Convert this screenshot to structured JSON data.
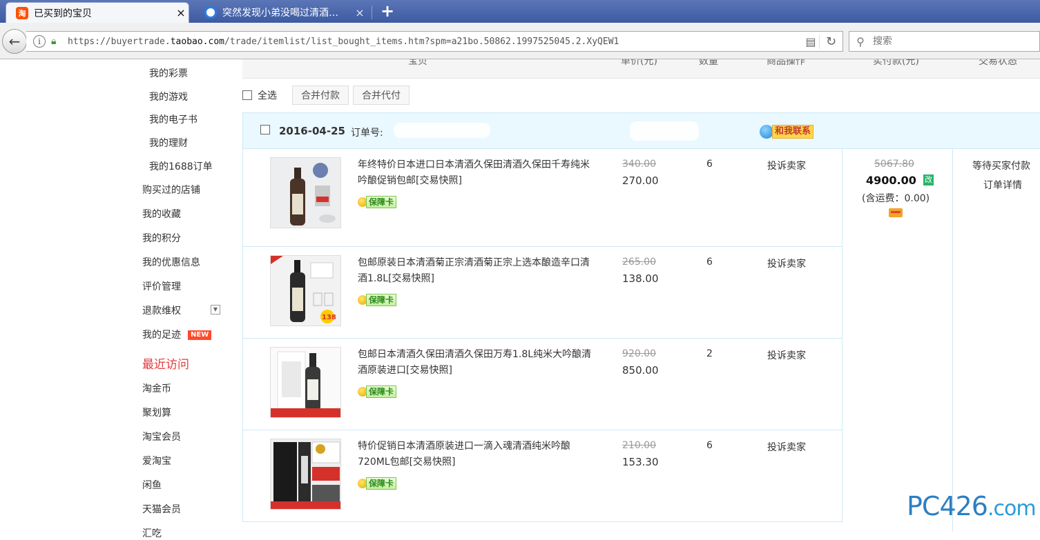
{
  "browser": {
    "tabs": [
      {
        "title": "已买到的宝贝",
        "favicon": "taobao-icon"
      },
      {
        "title": "突然发现小弟没喝过清酒…",
        "favicon": "globe-icon"
      }
    ],
    "new_tab": "+",
    "close": "×",
    "url_host": "https://buyertrade.",
    "url_domain": "taobao.com",
    "url_path": "/trade/itemlist/list_bought_items.htm?spm=a21bo.50862.1997525045.2.XyQEW1",
    "search_placeholder": "搜索"
  },
  "sidebar": {
    "sub_items": [
      "我的彩票",
      "我的游戏",
      "我的电子书",
      "我的理财",
      "我的1688订单"
    ],
    "items": [
      "购买过的店铺",
      "我的收藏",
      "我的积分",
      "我的优惠信息",
      "评价管理",
      "退款维权",
      "我的足迹"
    ],
    "new_badge": "NEW",
    "recent_heading": "最近访问",
    "recent": [
      "淘金币",
      "聚划算",
      "淘宝会员",
      "爱淘宝",
      "闲鱼",
      "天猫会员",
      "汇吃"
    ]
  },
  "table": {
    "columns": [
      "宝贝",
      "单价(元)",
      "数量",
      "商品操作",
      "实付款(元)",
      "交易状态"
    ]
  },
  "bulk": {
    "select_all": "全选",
    "merge_pay": "合并付款",
    "merge_proxy": "合并代付"
  },
  "order": {
    "date": "2016-04-25",
    "order_no_label": "订单号:",
    "contact": "和我联系",
    "items": [
      {
        "title": "年终特价日本进口日本清酒久保田清酒久保田千寿纯米吟酿促销包邮[交易快照]",
        "orig": "340.00",
        "price": "270.00",
        "qty": "6",
        "action": "投诉卖家",
        "badge": "保障卡"
      },
      {
        "title": "包邮原装日本清酒菊正宗清酒菊正宗上选本酿造辛口清酒1.8L[交易快照]",
        "orig": "265.00",
        "price": "138.00",
        "qty": "6",
        "action": "投诉卖家",
        "badge": "保障卡"
      },
      {
        "title": "包邮日本清酒久保田清酒久保田万寿1.8L纯米大吟酿清酒原装进口[交易快照]",
        "orig": "920.00",
        "price": "850.00",
        "qty": "2",
        "action": "投诉卖家",
        "badge": "保障卡"
      },
      {
        "title": "特价促销日本清酒原装进口一滴入魂清酒纯米吟酿720ML包邮[交易快照]",
        "orig": "210.00",
        "price": "153.30",
        "qty": "6",
        "action": "投诉卖家",
        "badge": "保障卡"
      }
    ],
    "payment": {
      "orig_total": "5067.80",
      "total": "4900.00",
      "modify": "改",
      "shipping": "(含运费：0.00)"
    },
    "status": {
      "state": "等待买家付款",
      "detail_link": "订单详情"
    }
  },
  "watermark": {
    "main": "PC426",
    "suffix": ".com"
  }
}
